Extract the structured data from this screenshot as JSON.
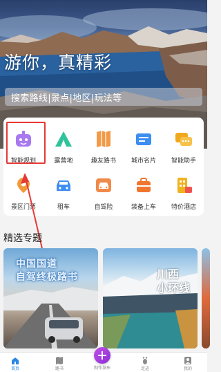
{
  "hero": {
    "title": "游你，真精彩",
    "search_placeholder": "搜索路线|景点|地区|玩法等"
  },
  "grid": [
    {
      "label": "智能规划",
      "icon": "robot-icon",
      "color": "#a979f0"
    },
    {
      "label": "露营地",
      "icon": "tent-icon",
      "color": "#2fc39c"
    },
    {
      "label": "趣友路书",
      "icon": "map-book-icon",
      "color": "#f29a48"
    },
    {
      "label": "城市名片",
      "icon": "city-card-icon",
      "color": "#3d8ef0"
    },
    {
      "label": "智能助手",
      "icon": "chat-assistant-icon",
      "color": "#f0a91e"
    },
    {
      "label": "景区门票",
      "icon": "ticket-icon",
      "color": "#f29a3a"
    },
    {
      "label": "租车",
      "icon": "car-rental-icon",
      "color": "#3d8ef0"
    },
    {
      "label": "自驾险",
      "icon": "insurance-car-icon",
      "color": "#f08a4b"
    },
    {
      "label": "装备上车",
      "icon": "equipment-bag-icon",
      "color": "#f0762f"
    },
    {
      "label": "特价酒店",
      "icon": "hotel-icon",
      "color": "#f0b21e"
    }
  ],
  "section": {
    "title": "精选专题"
  },
  "topics": [
    {
      "title_line1": "中国国道",
      "title_line2": "自驾终极路书"
    },
    {
      "title_line1": "川西",
      "title_line2": "小环线"
    }
  ],
  "tabbar": [
    {
      "label": "首页",
      "icon": "home-icon",
      "active": true
    },
    {
      "label": "路书",
      "icon": "map-icon",
      "active": false
    },
    {
      "label": "制作发布",
      "icon": "plus-icon",
      "active": false
    },
    {
      "label": "足迹",
      "icon": "footprint-icon",
      "active": false
    },
    {
      "label": "我的",
      "icon": "profile-icon",
      "active": false
    }
  ],
  "colors": {
    "accent": "#2a86e6",
    "highlight": "#e53935",
    "fab": "#a03be0"
  }
}
